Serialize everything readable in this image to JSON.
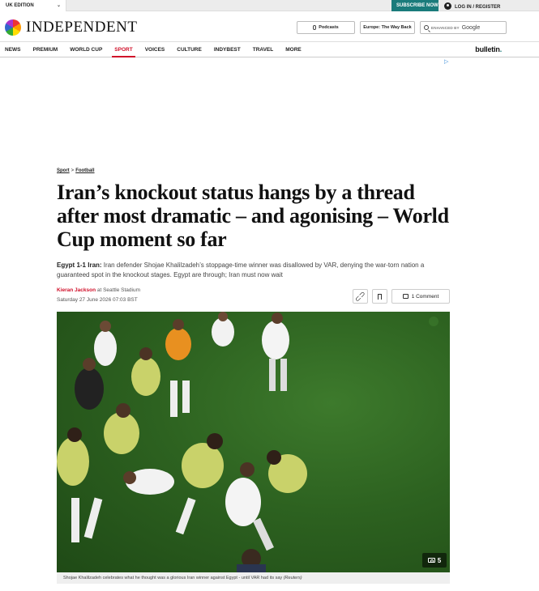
{
  "topbar": {
    "edition": "UK EDITION",
    "subscribe": "SUBSCRIBE NOW",
    "login": "LOG IN / REGISTER"
  },
  "masthead": {
    "logo": "INDEPENDENT",
    "podcasts": "Podcasts",
    "europe": "Europe: The Way Back",
    "search_enhanced": "ENHANCED BY",
    "search_google": "Google"
  },
  "nav": {
    "items": [
      "NEWS",
      "PREMIUM",
      "WORLD CUP",
      "SPORT",
      "VOICES",
      "CULTURE",
      "INDYBEST",
      "TRAVEL",
      "MORE"
    ],
    "active": "SPORT",
    "bulletin": "bulletin",
    "bulletin_dot": "."
  },
  "article": {
    "breadcrumb": [
      "Sport",
      "Football"
    ],
    "breadcrumb_sep": ">",
    "headline": "Iran’s knockout status hangs by a thread after most dramatic – and agonising – World Cup moment so far",
    "standfirst_lead": "Egypt 1-1 Iran:",
    "standfirst_body": " Iran defender Shojae Khalilzadeh’s stoppage-time winner was disallowed by VAR, denying the war-torn nation a guaranteed spot in the knockout stages. Egypt are through; Iran must now wait",
    "author": "Kieran Jackson",
    "location": " at Seattle Stadium",
    "date": "Saturday 27 June 2026 07:03 BST",
    "comments": "1 Comment",
    "gallery_count": "5",
    "caption": "Shojae Khalilzadeh celebrates what he thought was a glorious Iran winner against Egypt - until VAR had its say ",
    "caption_credit": "(Reuters)"
  },
  "colors": {
    "accent_red": "#d0102a",
    "subscribe_teal": "#1a7b7b",
    "pitch_green": "#2d6220"
  },
  "icons": [
    "chevron-down-icon",
    "user-icon",
    "microphone-icon",
    "search-icon",
    "adchoices-icon",
    "link-icon",
    "bookmark-icon",
    "comment-icon",
    "camera-icon"
  ]
}
